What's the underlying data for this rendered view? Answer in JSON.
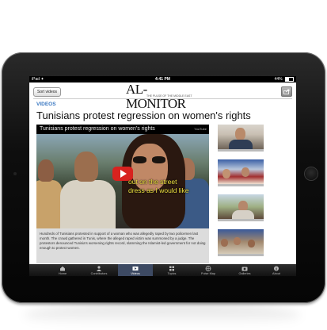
{
  "status_bar": {
    "carrier": "iPad ✦",
    "time": "4:41 PM",
    "battery": "44%"
  },
  "toolbar": {
    "sort_label": "Sort videos"
  },
  "logo": {
    "name": "AL-MONITOR",
    "tagline": "THE PULSE OF THE MIDDLE EAST"
  },
  "section_label": "VIDEOS",
  "headline": "Tunisians protest regression on women's rights",
  "player": {
    "title": "Tunisians protest regression on women's rights",
    "source": "YouTube",
    "subtitle_line1": "out on the street",
    "subtitle_line2": "dress as I would like"
  },
  "caption": "Hundreds of Tunisians protested in support of a woman who was allegedly raped by two policemen last month. The crowd gathered in Tunis, where the alleged raped victim was summoned by a judge. The protestors denounced Tunisia's worsening rights record, slamming the Islamist-led government for not doing enough to protect women.",
  "tabs": [
    {
      "label": "Home",
      "icon": "house-icon"
    },
    {
      "label": "Contributors",
      "icon": "person-icon"
    },
    {
      "label": "Videos",
      "icon": "film-icon",
      "active": true
    },
    {
      "label": "Topics",
      "icon": "grid-icon"
    },
    {
      "label": "Pulse Map",
      "icon": "globe-icon"
    },
    {
      "label": "Galleries",
      "icon": "camera-icon"
    },
    {
      "label": "About",
      "icon": "info-icon"
    }
  ],
  "colors": {
    "accent": "#3a78c2",
    "tab_active": "#3d4a63",
    "play_button": "#d8221f"
  }
}
